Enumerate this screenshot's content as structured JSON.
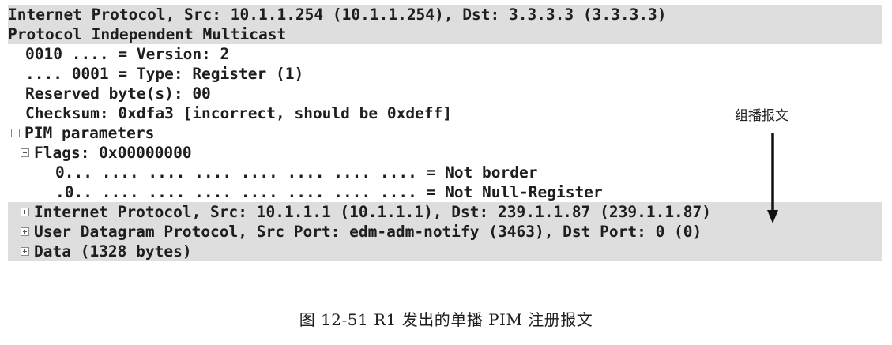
{
  "packet_tree": {
    "rows": [
      {
        "text": "Internet Protocol, Src: 10.1.1.254 (10.1.1.254), Dst: 3.3.3.3 (3.3.3.3)"
      },
      {
        "text": "Protocol Independent Multicast"
      },
      {
        "text": "0010 .... = Version: 2"
      },
      {
        "text": ".... 0001 = Type: Register (1)"
      },
      {
        "text": "Reserved byte(s): 00"
      },
      {
        "text": "Checksum: 0xdfa3 [incorrect, should be 0xdeff]"
      },
      {
        "text": "PIM parameters"
      },
      {
        "text": "Flags: 0x00000000"
      },
      {
        "text": "0... .... .... .... .... .... .... .... = Not border"
      },
      {
        "text": ".0.. .... .... .... .... .... .... .... = Not Null-Register"
      },
      {
        "text": "Internet Protocol, Src: 10.1.1.1 (10.1.1.1), Dst: 239.1.1.87 (239.1.1.87)"
      },
      {
        "text": "User Datagram Protocol, Src Port: edm-adm-notify (3463), Dst Port: 0 (0)"
      },
      {
        "text": "Data (1328 bytes)"
      }
    ]
  },
  "annotation": {
    "label": "组播报文",
    "arrow_color": "#111111"
  },
  "caption": "图 12-51   R1 发出的单播 PIM 注册报文",
  "colors": {
    "row_highlight": "#dedede",
    "text": "#1e1e1e"
  },
  "icons": {
    "expanded": "minus-box-icon",
    "collapsed": "plus-box-icon"
  }
}
